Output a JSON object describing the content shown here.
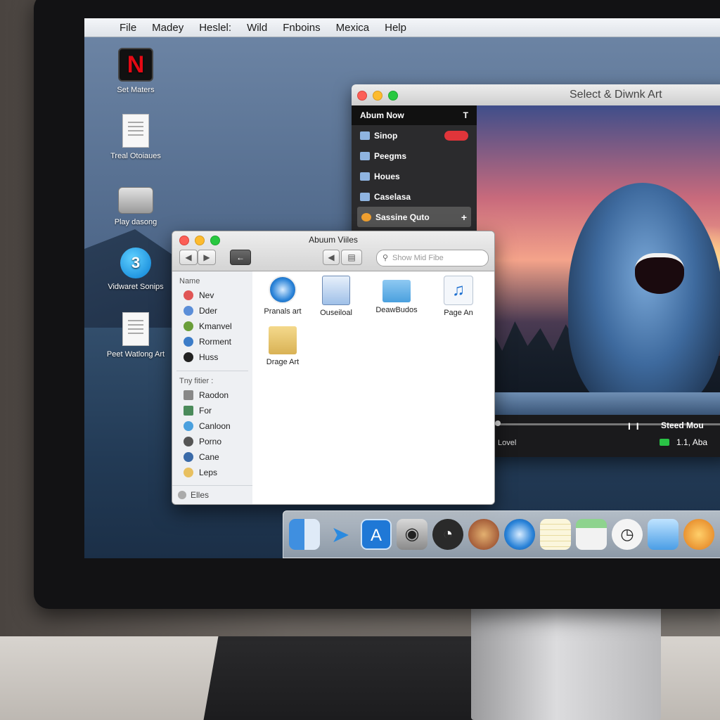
{
  "menubar": {
    "apple": "",
    "items": [
      "File",
      "Madey",
      "Heslel:",
      "Wild",
      "Fnboins",
      "Mexica",
      "Help"
    ]
  },
  "desktop_icons": [
    {
      "label": "Set Maters",
      "icon": "netflix-icon"
    },
    {
      "label": "Treal Otoiaues",
      "icon": "document-icon"
    },
    {
      "label": "Play dasong",
      "icon": "drive-icon"
    },
    {
      "label": "Vidwaret Sonips",
      "icon": "badge-icon",
      "badge": "3"
    },
    {
      "label": "Peet Watlong Art",
      "icon": "document-icon"
    }
  ],
  "player": {
    "title": "Select & Diwnk Art",
    "sidebar_header": "Abum Now",
    "sidebar_header_button": "T",
    "items": [
      {
        "label": "Sinop",
        "icon": "screen-icon"
      },
      {
        "label": "Peegms",
        "icon": "image-icon"
      },
      {
        "label": "Houes",
        "icon": "folder-icon"
      },
      {
        "label": "Caselasa",
        "icon": "lock-icon"
      },
      {
        "label": "Sassine Quto",
        "icon": "star-icon"
      }
    ],
    "pause": "I I",
    "status": "Steed Mou",
    "level_label": "Lovel",
    "time": "1.1, Aba"
  },
  "finder": {
    "title": "Abuum Viiles",
    "search_placeholder": "Show Mid Fibe",
    "sidebar_heading": "Name",
    "favorites": [
      "Nev",
      "Dder",
      "Kmanvel",
      "Rorment",
      "Huss"
    ],
    "filter_heading": "Tny fitier :",
    "filters": [
      "Raodon",
      "For",
      "Canloon",
      "Porno",
      "Cane",
      "Leps"
    ],
    "bottom_label": "Elles",
    "files": [
      {
        "label": "Pranals art",
        "icon": "safari-icon"
      },
      {
        "label": "Ouseiloal",
        "icon": "newspaper-icon"
      },
      {
        "label": "DeawBudos",
        "icon": "folder-icon"
      },
      {
        "label": "Page An",
        "icon": "music-icon"
      },
      {
        "label": "Drage Art",
        "icon": "archive-icon"
      }
    ]
  },
  "dock": [
    "finder-icon",
    "cursor-icon",
    "app-store-icon",
    "camera-icon",
    "dashboard-icon",
    "gauge-icon",
    "safari-icon",
    "notes-icon",
    "mail-icon",
    "clock-icon",
    "preview-icon",
    "profile-icon"
  ],
  "colors": {
    "accent": "#2a83d8",
    "close": "#fc5f57",
    "minimize": "#fdbb2e",
    "zoom": "#28c840"
  }
}
